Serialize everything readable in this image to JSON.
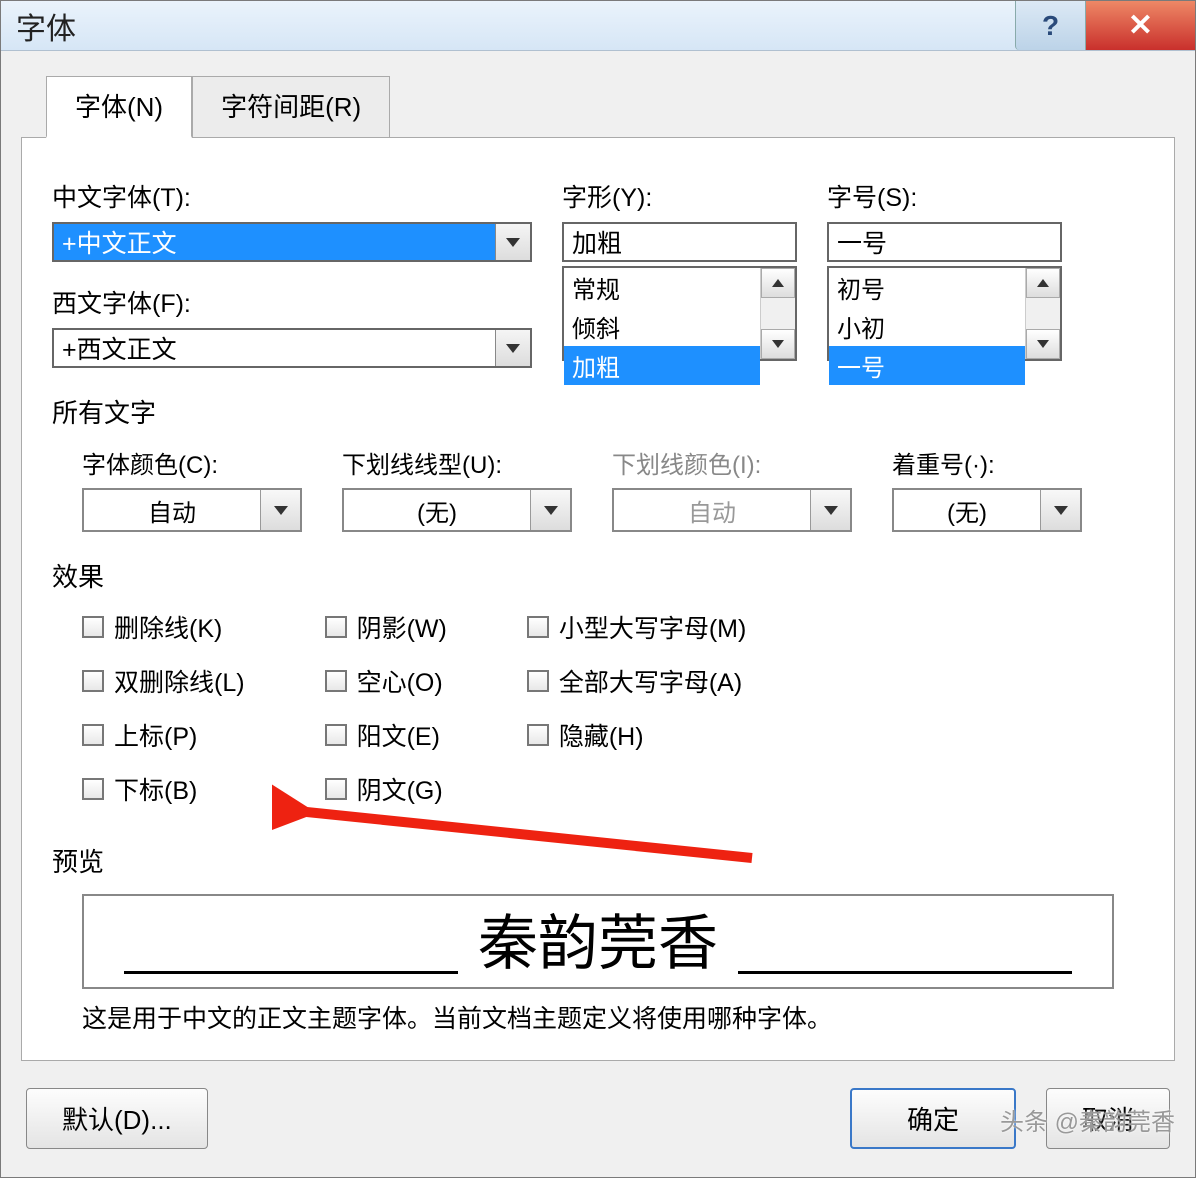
{
  "title": "字体",
  "tabs": {
    "font": "字体(N)",
    "spacing": "字符间距(R)"
  },
  "font": {
    "chinese_label": "中文字体(T):",
    "chinese_value": "+中文正文",
    "western_label": "西文字体(F):",
    "western_value": "+西文正文",
    "style_label": "字形(Y):",
    "style_value": "加粗",
    "style_options": [
      "常规",
      "倾斜",
      "加粗"
    ],
    "size_label": "字号(S):",
    "size_value": "一号",
    "size_options": [
      "初号",
      "小初",
      "一号"
    ]
  },
  "all_text_label": "所有文字",
  "color": {
    "label": "字体颜色(C):",
    "value": "自动"
  },
  "underline": {
    "label": "下划线线型(U):",
    "value": "(无)"
  },
  "underline_color": {
    "label": "下划线颜色(I):",
    "value": "自动"
  },
  "emphasis": {
    "label": "着重号(·):",
    "value": "(无)"
  },
  "effects_label": "效果",
  "effects": {
    "strike": "删除线(K)",
    "dblstrike": "双删除线(L)",
    "superscript": "上标(P)",
    "subscript": "下标(B)",
    "shadow": "阴影(W)",
    "outline": "空心(O)",
    "emboss": "阳文(E)",
    "engrave": "阴文(G)",
    "smallcaps": "小型大写字母(M)",
    "allcaps": "全部大写字母(A)",
    "hidden": "隐藏(H)"
  },
  "preview_label": "预览",
  "preview_text": "秦韵莞香",
  "preview_note": "这是用于中文的正文主题字体。当前文档主题定义将使用哪种字体。",
  "buttons": {
    "default": "默认(D)...",
    "ok": "确定",
    "cancel": "取消"
  },
  "watermark": "头条 @秦韵莞香"
}
